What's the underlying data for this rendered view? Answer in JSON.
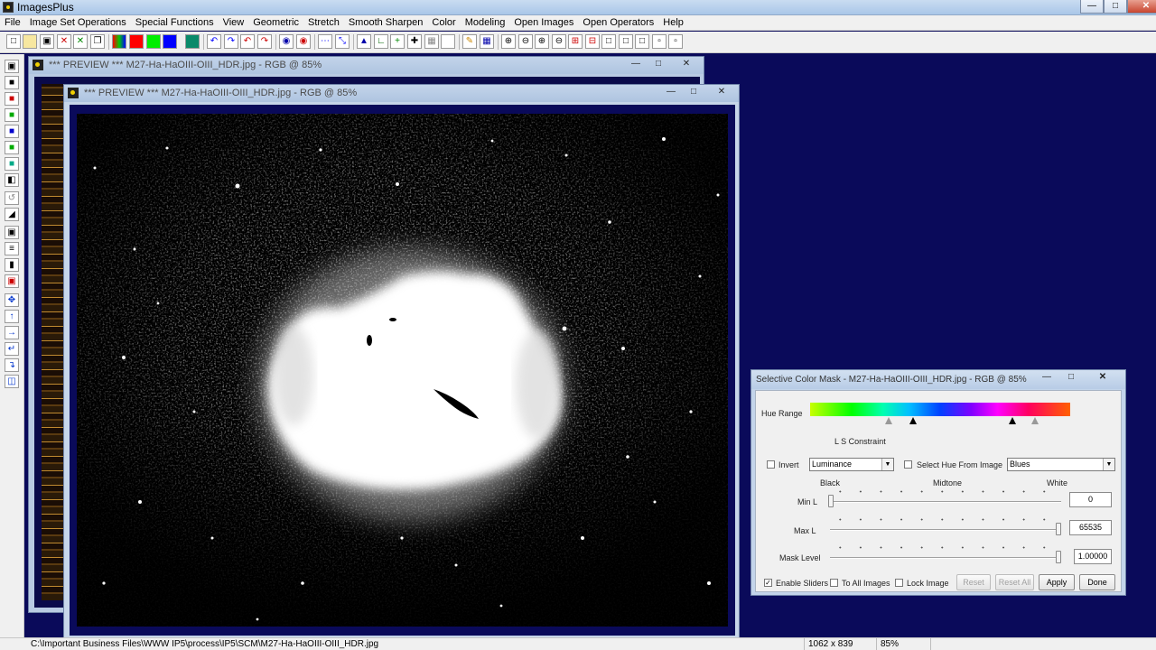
{
  "app": {
    "title": "ImagesPlus"
  },
  "menu": [
    "File",
    "Image Set Operations",
    "Special Functions",
    "View",
    "Geometric",
    "Stretch",
    "Smooth Sharpen",
    "Color",
    "Modeling",
    "Open Images",
    "Open Operators",
    "Help"
  ],
  "windows": {
    "back_title": "*** PREVIEW *** M27-Ha-HaOIII-OIII_HDR.jpg - RGB @ 85%",
    "front_title": "*** PREVIEW *** M27-Ha-HaOIII-OIII_HDR.jpg - RGB @ 85%"
  },
  "dialog": {
    "title": "Selective Color Mask - M27-Ha-HaOIII-OIII_HDR.jpg - RGB @ 85%",
    "hue_range_label": "Hue Range",
    "ls_constraint_label": "L S Constraint",
    "invert_label": "Invert",
    "invert_checked": false,
    "constraint_value": "Luminance",
    "select_hue_label": "Select Hue From Image",
    "select_hue_checked": false,
    "hue_preset_value": "Blues",
    "black_label": "Black",
    "midtone_label": "Midtone",
    "white_label": "White",
    "min_l_label": "Min L",
    "min_l_value": "0",
    "max_l_label": "Max L",
    "max_l_value": "65535",
    "mask_level_label": "Mask Level",
    "mask_level_value": "1.00000",
    "enable_sliders_label": "Enable Sliders",
    "enable_sliders_checked": true,
    "to_all_images_label": "To All Images",
    "lock_image_label": "Lock Image",
    "buttons": {
      "reset": "Reset",
      "reset_all": "Reset All",
      "apply": "Apply",
      "done": "Done"
    }
  },
  "status": {
    "path": "C:\\Important Business Files\\WWW IP5\\process\\IP5\\SCM\\M27-Ha-HaOIII-OIII_HDR.jpg",
    "dimensions": "1062 x 839",
    "zoom": "85%"
  }
}
